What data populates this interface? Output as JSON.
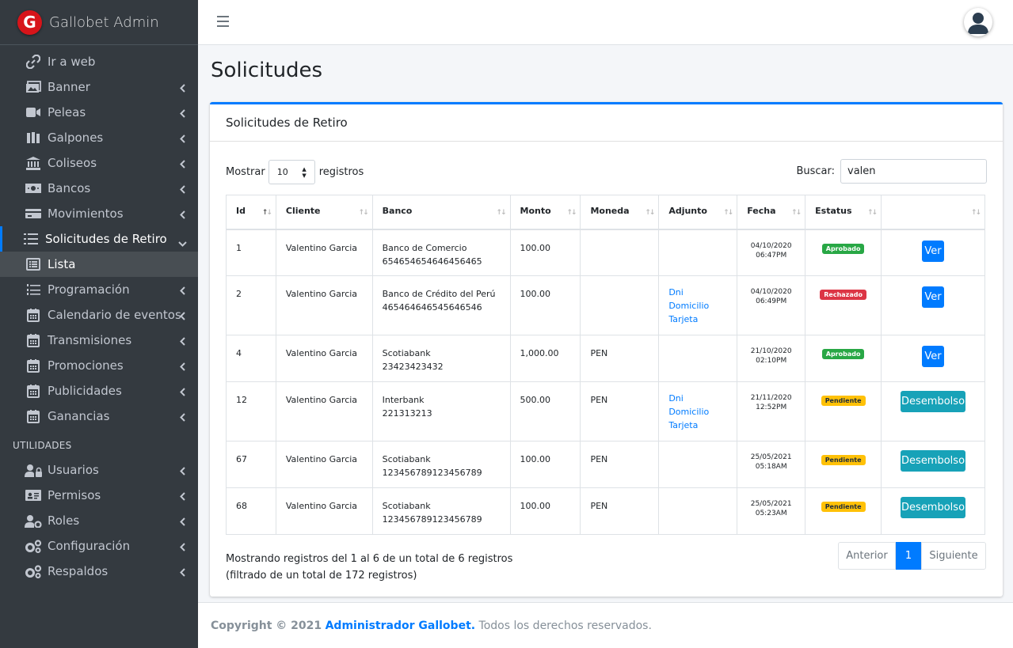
{
  "brand": {
    "logo_letter": "G",
    "name": "Gallobet Admin"
  },
  "sidebar": {
    "items": [
      {
        "label": "Ir a web",
        "icon": "link-icon",
        "chevron": false
      },
      {
        "label": "Banner",
        "icon": "images-icon",
        "chevron": true
      },
      {
        "label": "Peleas",
        "icon": "video-icon",
        "chevron": true
      },
      {
        "label": "Galpones",
        "icon": "book-icon",
        "chevron": true
      },
      {
        "label": "Coliseos",
        "icon": "landmark-icon",
        "chevron": true
      },
      {
        "label": "Bancos",
        "icon": "money-icon",
        "chevron": true
      },
      {
        "label": "Movimientos",
        "icon": "credit-card-icon",
        "chevron": true
      },
      {
        "label": "Solicitudes de Retiro",
        "icon": "list-icon",
        "chevron": true,
        "active": true
      },
      {
        "label": "Lista",
        "icon": "list-alt-icon",
        "chevron": false,
        "child": true
      },
      {
        "label": "Programación",
        "icon": "list-ol-icon",
        "chevron": true
      },
      {
        "label": "Calendario de eventos",
        "icon": "calendar-icon",
        "chevron": true
      },
      {
        "label": "Transmisiones",
        "icon": "calendar-icon",
        "chevron": true
      },
      {
        "label": "Promociones",
        "icon": "calendar-icon",
        "chevron": true
      },
      {
        "label": "Publicidades",
        "icon": "calendar-icon",
        "chevron": true
      },
      {
        "label": "Ganancias",
        "icon": "calendar-icon",
        "chevron": true
      }
    ],
    "header": "UTILIDADES",
    "utils": [
      {
        "label": "Usuarios",
        "icon": "user-lock-icon"
      },
      {
        "label": "Permisos",
        "icon": "id-card-icon"
      },
      {
        "label": "Roles",
        "icon": "user-cog-icon"
      },
      {
        "label": "Configuración",
        "icon": "cogs-icon"
      },
      {
        "label": "Respaldos",
        "icon": "cogs-icon"
      }
    ]
  },
  "page": {
    "title": "Solicitudes"
  },
  "card": {
    "title": "Solicitudes de Retiro",
    "show_label": "Mostrar",
    "show_value": "10",
    "records_label": "registros",
    "search_label": "Buscar:",
    "search_value": "valen"
  },
  "table": {
    "headers": [
      "Id",
      "Cliente",
      "Banco",
      "Monto",
      "Moneda",
      "Adjunto",
      "Fecha",
      "Estatus",
      ""
    ],
    "rows": [
      {
        "id": "1",
        "cliente": "Valentino Garcia",
        "banco": "Banco de Comercio",
        "cuenta": "654654654646456465",
        "monto": "100.00",
        "moneda": "",
        "adjuntos": [],
        "fecha": "04/10/2020",
        "hora": "06:47PM",
        "estatus": "Aprobado",
        "accion": "Ver"
      },
      {
        "id": "2",
        "cliente": "Valentino Garcia",
        "banco": "Banco de Crédito del Perú",
        "cuenta": "465464646545646546",
        "monto": "100.00",
        "moneda": "",
        "adjuntos": [
          "Dni",
          "Domicilio",
          "Tarjeta"
        ],
        "fecha": "04/10/2020",
        "hora": "06:49PM",
        "estatus": "Rechazado",
        "accion": "Ver"
      },
      {
        "id": "4",
        "cliente": "Valentino Garcia",
        "banco": "Scotiabank",
        "cuenta": "23423423432",
        "monto": "1,000.00",
        "moneda": "PEN",
        "adjuntos": [],
        "fecha": "21/10/2020",
        "hora": "02:10PM",
        "estatus": "Aprobado",
        "accion": "Ver"
      },
      {
        "id": "12",
        "cliente": "Valentino Garcia",
        "banco": "Interbank",
        "cuenta": "221313213",
        "monto": "500.00",
        "moneda": "PEN",
        "adjuntos": [
          "Dni",
          "Domicilio",
          "Tarjeta"
        ],
        "fecha": "21/11/2020",
        "hora": "12:52PM",
        "estatus": "Pendiente",
        "accion": "Desembolso"
      },
      {
        "id": "67",
        "cliente": "Valentino Garcia",
        "banco": "Scotiabank",
        "cuenta": "123456789123456789",
        "monto": "100.00",
        "moneda": "PEN",
        "adjuntos": [],
        "fecha": "25/05/2021",
        "hora": "05:18AM",
        "estatus": "Pendiente",
        "accion": "Desembolso"
      },
      {
        "id": "68",
        "cliente": "Valentino Garcia",
        "banco": "Scotiabank",
        "cuenta": "123456789123456789",
        "monto": "100.00",
        "moneda": "PEN",
        "adjuntos": [],
        "fecha": "25/05/2021",
        "hora": "05:23AM",
        "estatus": "Pendiente",
        "accion": "Desembolso"
      }
    ]
  },
  "info": "Mostrando registros del 1 al 6 de un total de 6 registros (filtrado de un total de 172 registros)",
  "pager": {
    "prev": "Anterior",
    "current": "1",
    "next": "Siguiente"
  },
  "footer": {
    "prefix": "Copyright © 2021",
    "brand": "Administrador Gallobet.",
    "suffix": "Todos los derechos reservados."
  },
  "colors": {
    "primary": "#007bff",
    "info": "#17a2b8",
    "success": "#28a745",
    "danger": "#dc3545",
    "warning": "#ffc107",
    "sidebar": "#343a40"
  }
}
